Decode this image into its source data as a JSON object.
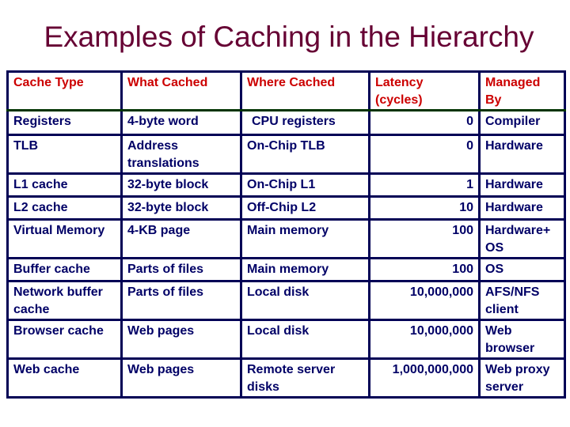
{
  "title": "Examples of Caching in the Hierarchy",
  "table": {
    "headers": [
      "Cache Type",
      "What Cached",
      "Where Cached",
      "Latency (cycles)",
      "Managed By"
    ],
    "rows": [
      [
        "Registers",
        "4-byte word",
        "CPU registers",
        "0",
        "Compiler"
      ],
      [
        "TLB",
        "Address translations",
        "On-Chip TLB",
        "0",
        "Hardware"
      ],
      [
        "L1 cache",
        "32-byte block",
        "On-Chip L1",
        "1",
        "Hardware"
      ],
      [
        "L2 cache",
        "32-byte block",
        "Off-Chip L2",
        "10",
        "Hardware"
      ],
      [
        "Virtual Memory",
        "4-KB page",
        "Main memory",
        "100",
        "Hardware+ OS"
      ],
      [
        "Buffer cache",
        "Parts of files",
        "Main memory",
        "100",
        "OS"
      ],
      [
        "Network buffer cache",
        "Parts of files",
        "Local disk",
        "10,000,000",
        "AFS/NFS client"
      ],
      [
        "Browser cache",
        "Web pages",
        "Local disk",
        "10,000,000",
        "Web browser"
      ],
      [
        "Web cache",
        "Web pages",
        "Remote server disks",
        "1,000,000,000",
        "Web proxy server"
      ]
    ]
  },
  "colors": {
    "title": "#660033",
    "header_text": "#cc0000",
    "body_text": "#000066",
    "border": "#000055",
    "header_separator": "#003300"
  }
}
